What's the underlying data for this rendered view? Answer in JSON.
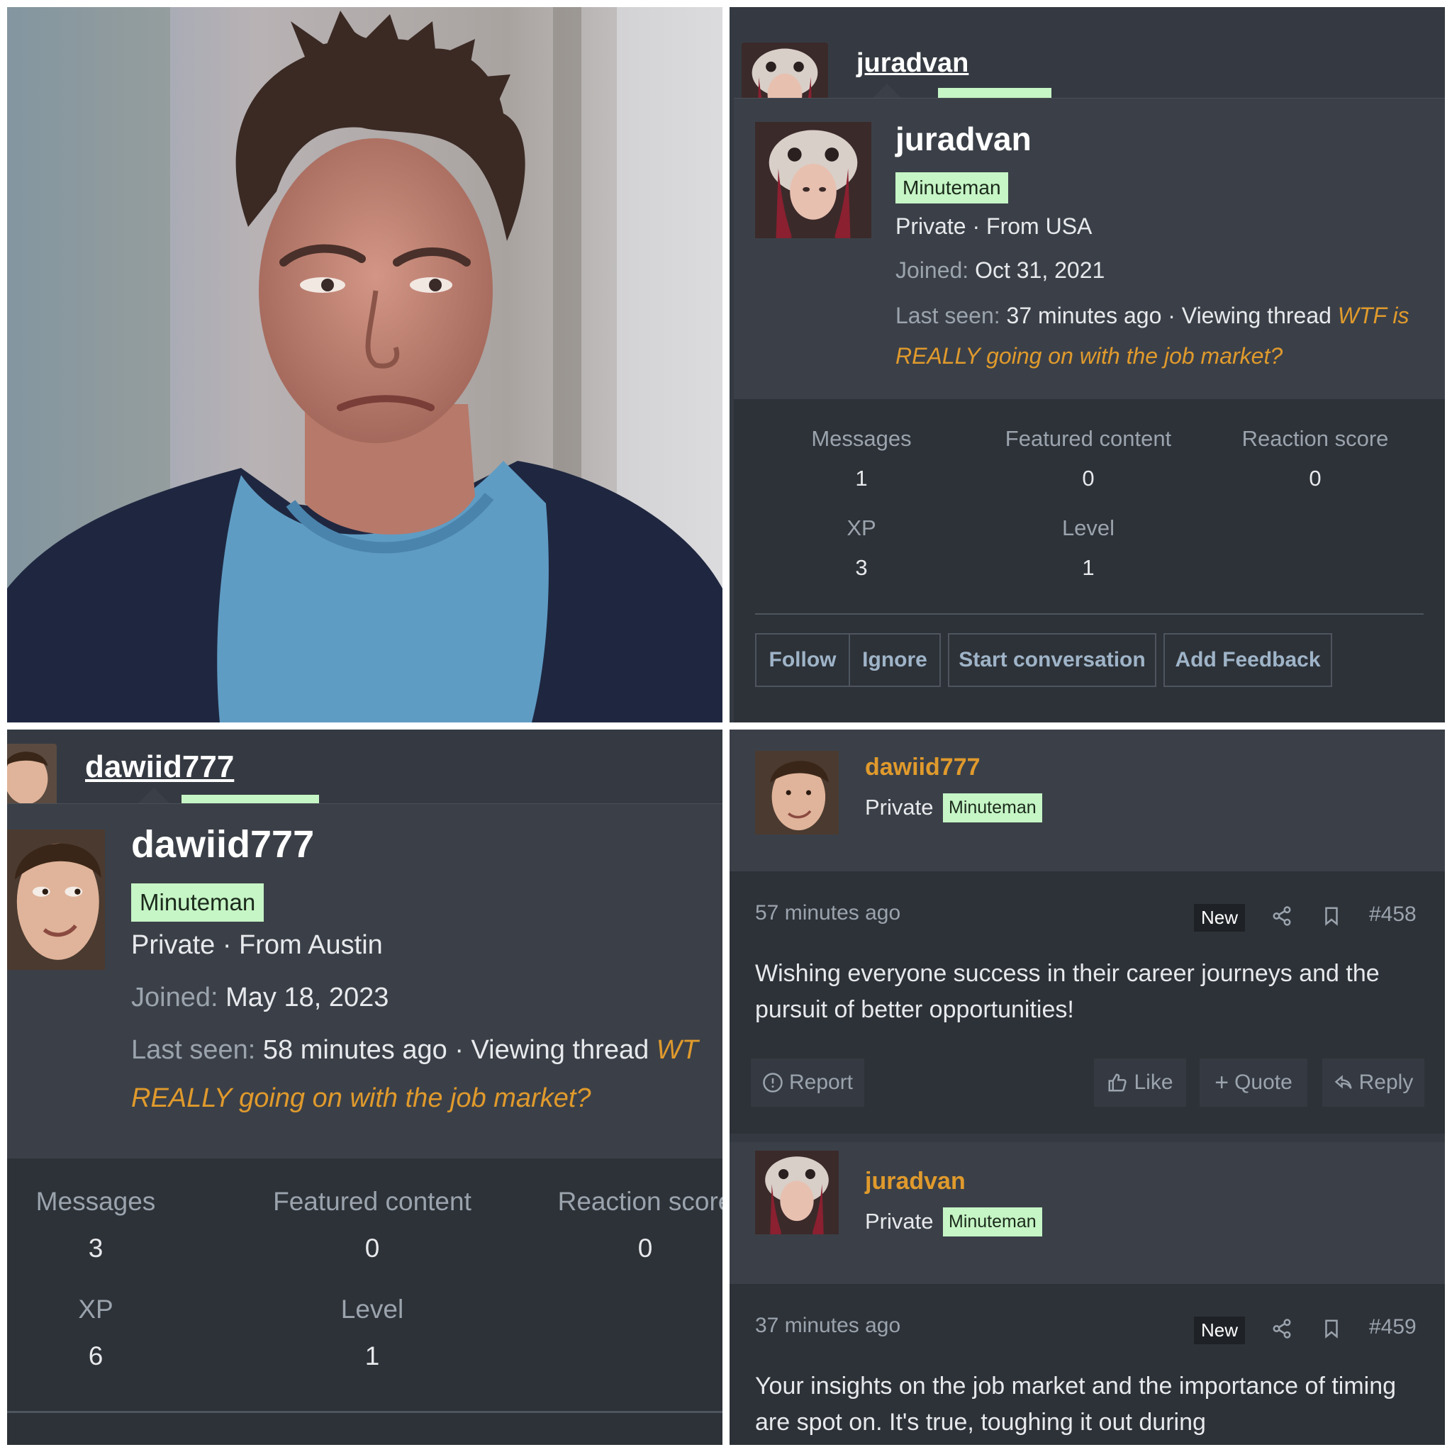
{
  "card_juradvan": {
    "username": "juradvan",
    "badge": "Minuteman",
    "rank_origin": "Private · From USA",
    "joined_label": "Joined:",
    "joined_value": "Oct 31, 2021",
    "last_seen_label": "Last seen:",
    "last_seen_value": "37 minutes ago",
    "viewing_label": "· Viewing thread",
    "thread_title_1": "WTF is",
    "thread_title_2": "REALLY going on with the job market?",
    "stats": {
      "messages_label": "Messages",
      "messages_value": "1",
      "featured_label": "Featured content",
      "featured_value": "0",
      "reaction_label": "Reaction score",
      "reaction_value": "0",
      "xp_label": "XP",
      "xp_value": "3",
      "level_label": "Level",
      "level_value": "1"
    },
    "buttons": {
      "follow": "Follow",
      "ignore": "Ignore",
      "start_conversation": "Start conversation",
      "add_feedback": "Add Feedback"
    }
  },
  "card_dawiid": {
    "username": "dawiid777",
    "badge": "Minuteman",
    "rank_origin": "Private · From Austin",
    "joined_label": "Joined:",
    "joined_value": "May 18, 2023",
    "last_seen_label": "Last seen:",
    "last_seen_value": "58 minutes ago",
    "viewing_label": "· Viewing thread",
    "thread_title_1": "WT",
    "thread_title_2": "REALLY going on with the job market?",
    "stats": {
      "messages_label": "Messages",
      "messages_value": "3",
      "featured_label": "Featured content",
      "featured_value": "0",
      "reaction_label": "Reaction score",
      "reaction_value": "0",
      "xp_label": "XP",
      "xp_value": "6",
      "level_label": "Level",
      "level_value": "1"
    }
  },
  "posts": [
    {
      "username": "dawiid777",
      "rank": "Private",
      "badge": "Minuteman",
      "time": "57 minutes ago",
      "new_label": "New",
      "number": "#458",
      "text": "Wishing everyone success in their career journeys and the pursuit of better opportunities!",
      "report": "Report",
      "like": "Like",
      "quote": "Quote",
      "reply": "Reply"
    },
    {
      "username": "juradvan",
      "rank": "Private",
      "badge": "Minuteman",
      "time": "37 minutes ago",
      "new_label": "New",
      "number": "#459",
      "text": "Your insights on the job market and the importance of timing are spot on. It's true, toughing it out during"
    }
  ],
  "icons": {
    "share": "share-icon",
    "bookmark": "bookmark-icon",
    "report": "alert-circle-icon",
    "like": "thumbs-up-icon",
    "quote": "plus-icon",
    "reply": "reply-arrow-icon"
  },
  "colors": {
    "background": "#353a42",
    "card": "#3b4048",
    "stats_bg": "#2d3238",
    "badge": "#c6f5c6",
    "accent_orange": "#e09a2c",
    "button_text": "#9fb4c8"
  }
}
